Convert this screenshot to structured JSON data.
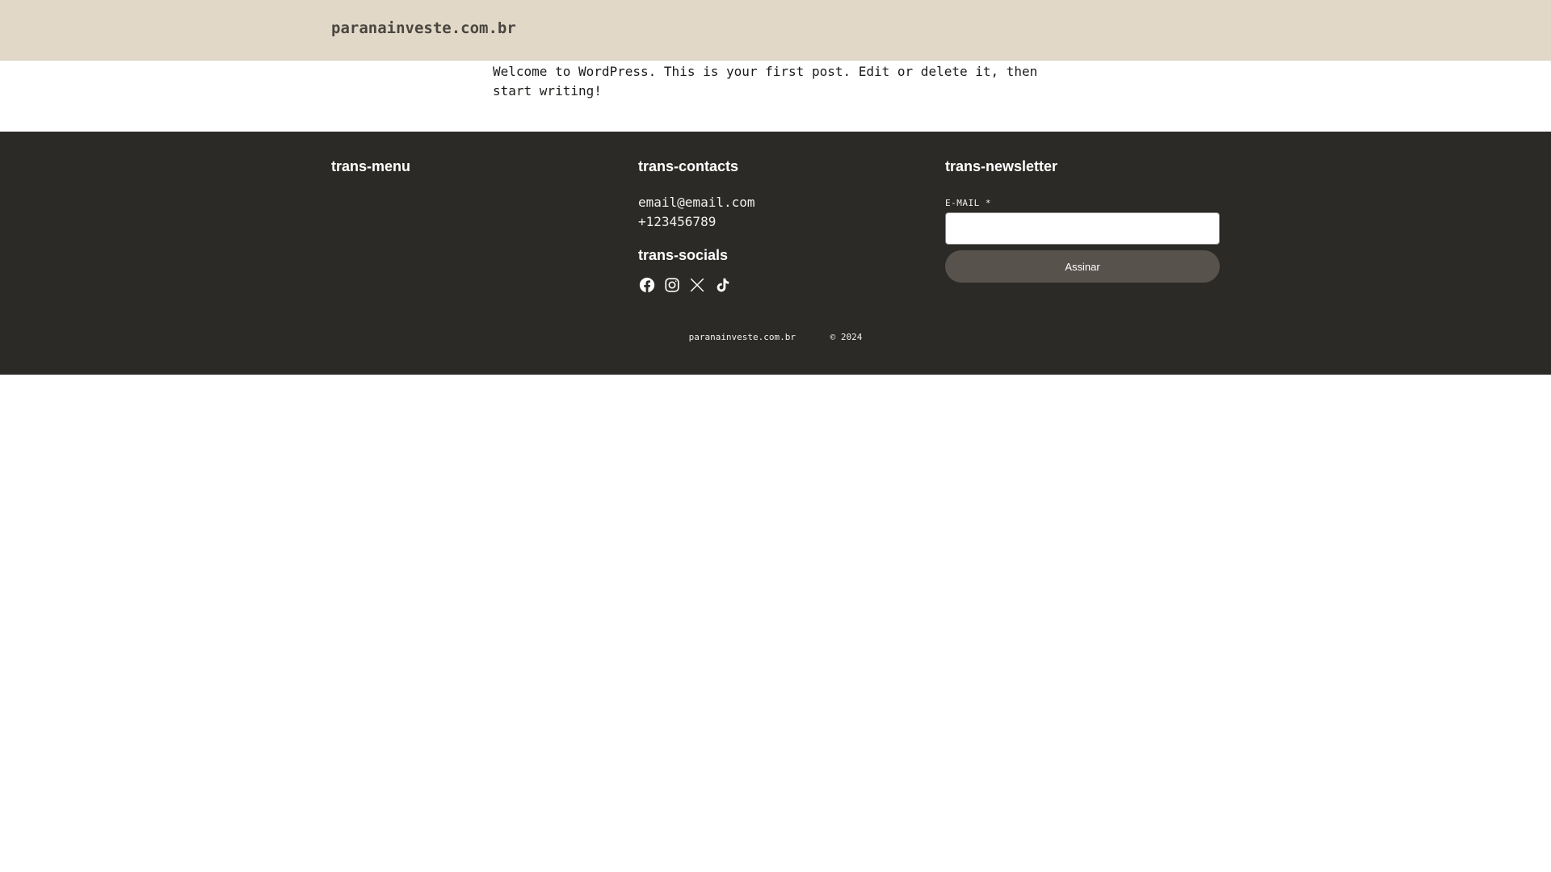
{
  "header": {
    "site_title": "paranainveste.com.br"
  },
  "post": {
    "content": "Welcome to WordPress. This is your first post. Edit or delete it, then start writing!"
  },
  "footer": {
    "menu": {
      "heading": "trans-menu"
    },
    "contacts": {
      "heading": "trans-contacts",
      "email": "email@email.com",
      "phone": "+123456789"
    },
    "socials": {
      "heading": "trans-socials",
      "icons": [
        "facebook-icon",
        "instagram-icon",
        "x-icon",
        "tiktok-icon"
      ]
    },
    "newsletter": {
      "heading": "trans-newsletter",
      "email_label": "E-MAIL *",
      "email_value": "",
      "button_label": "Assinar"
    },
    "bottom": {
      "site_name": "paranainveste.com.br",
      "copyright": "© 2024"
    }
  },
  "colors": {
    "header_bg": "#e2d8c7",
    "footer_bg": "#2c2a27",
    "button_bg": "#57524c"
  }
}
